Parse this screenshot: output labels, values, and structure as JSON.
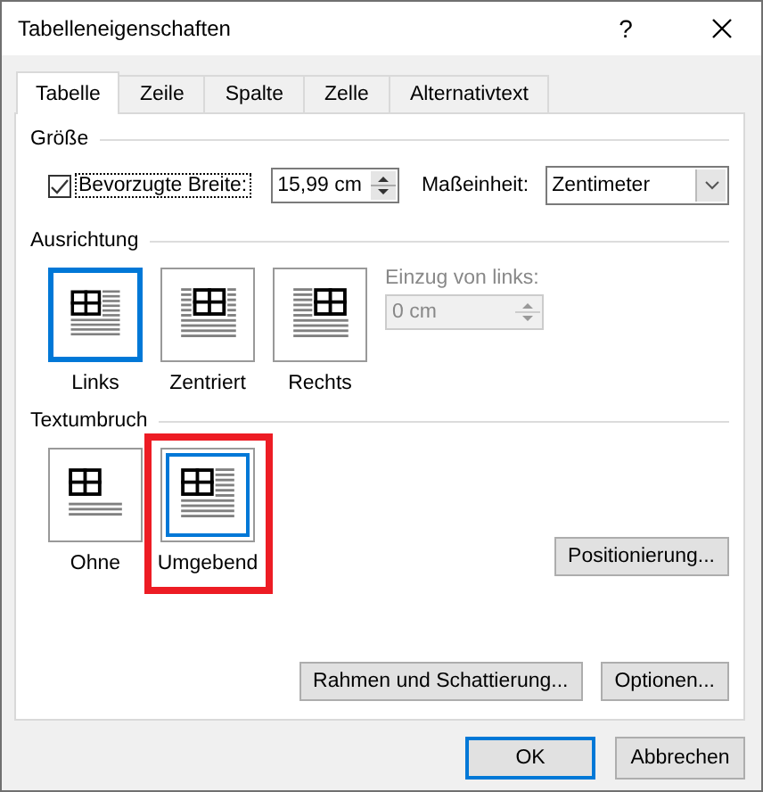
{
  "window": {
    "title": "Tabelleneigenschaften",
    "help": "?"
  },
  "tabs": [
    {
      "label": "Tabelle",
      "selected": true
    },
    {
      "label": "Zeile",
      "selected": false
    },
    {
      "label": "Spalte",
      "selected": false
    },
    {
      "label": "Zelle",
      "selected": false
    },
    {
      "label": "Alternativtext",
      "selected": false
    }
  ],
  "size": {
    "heading": "Größe",
    "preferred_width": {
      "label": "Bevorzugte Breite:",
      "checked": true,
      "value": "15,99 cm"
    },
    "unit": {
      "label": "Maßeinheit:",
      "value": "Zentimeter"
    }
  },
  "alignment": {
    "heading": "Ausrichtung",
    "options": [
      {
        "kind": "left",
        "label": "Links",
        "selected": true
      },
      {
        "kind": "center",
        "label": "Zentriert",
        "selected": false
      },
      {
        "kind": "right",
        "label": "Rechts",
        "selected": false
      }
    ],
    "indent": {
      "label": "Einzug von links:",
      "value": "0 cm",
      "disabled": true
    }
  },
  "wrapping": {
    "heading": "Textumbruch",
    "options": [
      {
        "kind": "none",
        "label": "Ohne",
        "selected": false,
        "highlighted": false
      },
      {
        "kind": "around",
        "label": "Umgebend",
        "selected": true,
        "highlighted": true
      }
    ],
    "positioning_button": "Positionierung..."
  },
  "panel_buttons": [
    "Rahmen und Schattierung...",
    "Optionen..."
  ],
  "footer_buttons": [
    {
      "label": "OK",
      "default": true
    },
    {
      "label": "Abbrechen",
      "default": false
    }
  ]
}
